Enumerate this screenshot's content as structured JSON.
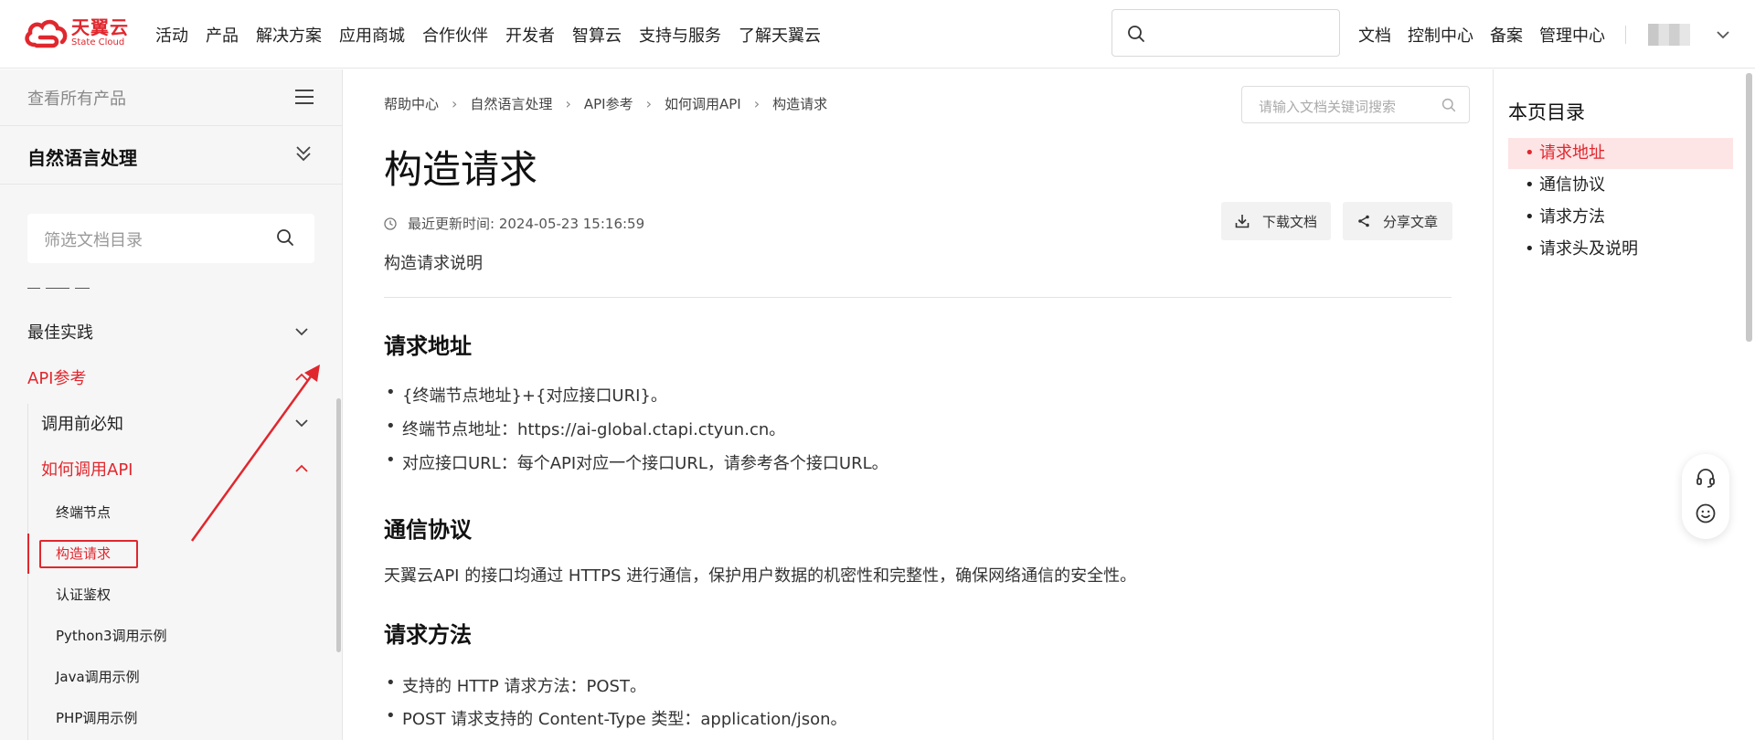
{
  "brand": {
    "name_cn": "天翼云",
    "name_en": "State Cloud",
    "color": "#e0272e"
  },
  "nav": [
    "活动",
    "产品",
    "解决方案",
    "应用商城",
    "合作伙伴",
    "开发者",
    "智算云",
    "支持与服务",
    "了解天翼云"
  ],
  "right_links": [
    "文档",
    "控制中心",
    "备案",
    "管理中心"
  ],
  "sidebar": {
    "all_products": "查看所有产品",
    "product": "自然语言处理",
    "filter_placeholder": "筛选文档目录",
    "items": [
      {
        "label": "最佳实践"
      },
      {
        "label": "API参考"
      },
      {
        "label": "调用前必知"
      },
      {
        "label": "如何调用API"
      }
    ],
    "subitems": [
      {
        "label": "终端节点"
      },
      {
        "label": "构造请求"
      },
      {
        "label": "认证鉴权"
      },
      {
        "label": "Python3调用示例"
      },
      {
        "label": "Java调用示例"
      },
      {
        "label": "PHP调用示例"
      }
    ]
  },
  "breadcrumb": [
    "帮助中心",
    "自然语言处理",
    "API参考",
    "如何调用API",
    "构造请求"
  ],
  "doc_search_placeholder": "请输入文档关键词搜索",
  "page": {
    "title": "构造请求",
    "updated": "最近更新时间: 2024-05-23 15:16:59",
    "download_label": "下载文档",
    "share_label": "分享文章",
    "intro": "构造请求说明",
    "sections": {
      "address": {
        "heading": "请求地址",
        "bullets": [
          "{终端节点地址}+{对应接口URI}。",
          "终端节点地址：https://ai-global.ctapi.ctyun.cn。",
          "对应接口URL：每个API对应一个接口URL，请参考各个接口URL。"
        ]
      },
      "protocol": {
        "heading": "通信协议",
        "text": "天翼云API 的接口均通过 HTTPS 进行通信，保护用户数据的机密性和完整性，确保网络通信的安全性。"
      },
      "method": {
        "heading": "请求方法",
        "bullets": [
          "支持的 HTTP 请求方法：POST。",
          "POST 请求支持的 Content-Type 类型：application/json。"
        ]
      }
    }
  },
  "toc": {
    "title": "本页目录",
    "items": [
      "请求地址",
      "通信协议",
      "请求方法",
      "请求头及说明"
    ]
  }
}
